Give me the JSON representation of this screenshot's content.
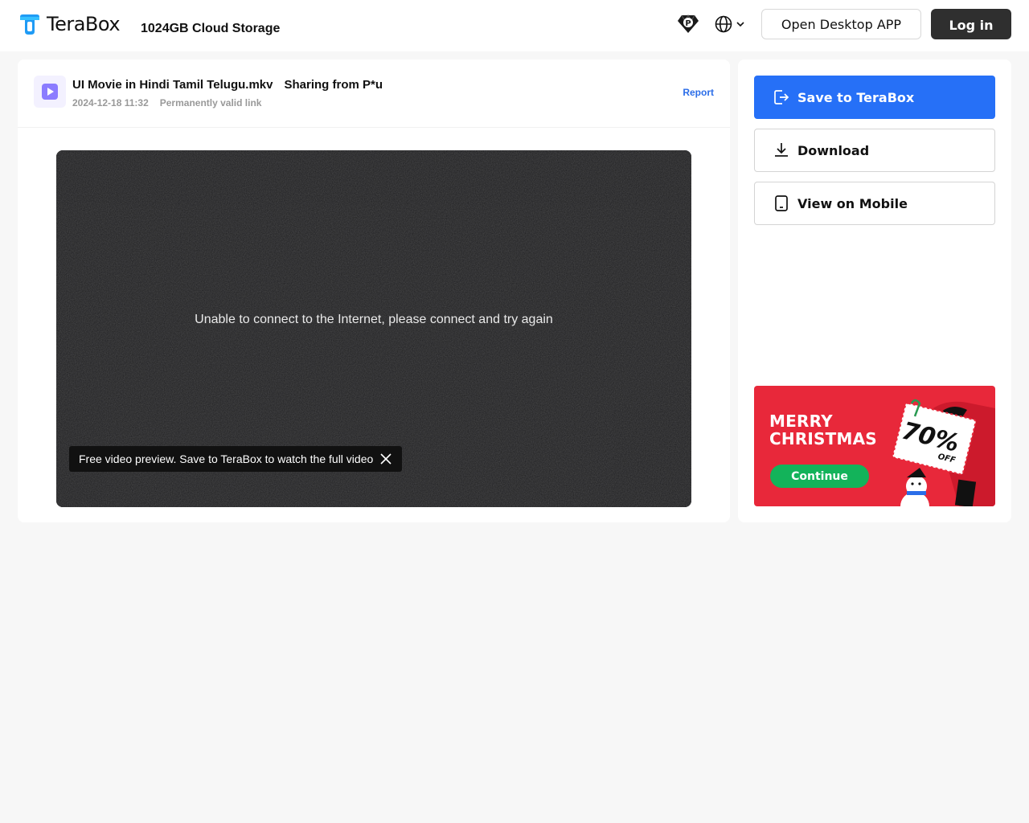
{
  "header": {
    "brand": "TeraBox",
    "tagline": "1024GB Cloud Storage",
    "open_desktop_label": "Open Desktop APP",
    "login_label": "Log in",
    "icons": {
      "premium": "premium-diamond-icon",
      "language": "globe-icon"
    }
  },
  "file": {
    "name": "UI Movie in Hindi Tamil Telugu.mkv",
    "sharing": "Sharing from P*u",
    "date": "2024-12-18 11:32",
    "validity": "Permanently valid link",
    "report_label": "Report",
    "icon": "video-file-icon"
  },
  "video": {
    "message": "Unable to connect to the Internet, please connect and try again",
    "preview_tip": "Free video preview. Save to TeraBox to watch the full video"
  },
  "actions": {
    "save_label": "Save to TeraBox",
    "download_label": "Download",
    "mobile_label": "View on Mobile"
  },
  "promo": {
    "title_line1": "MERRY",
    "title_line2": "CHRISTMAS",
    "discount": "70%",
    "discount_suffix": "OFF",
    "button_label": "Continue"
  },
  "colors": {
    "accent": "#2670f7",
    "login_bg": "#2f2f2f",
    "promo_bg": "#e8283a",
    "promo_button": "#13b35a",
    "link": "#2b6de8"
  }
}
